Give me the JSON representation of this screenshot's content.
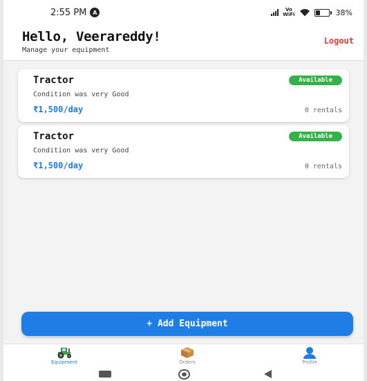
{
  "status_bar": {
    "time": "2:55 PM",
    "network_label_top": "Vo",
    "network_label_bottom": "WiFi",
    "battery": "38%",
    "battery_level": 0.38
  },
  "header": {
    "greeting": "Hello, Veerareddy!",
    "subtitle": "Manage your equipment",
    "logout_label": "Logout"
  },
  "equipment": [
    {
      "name": "Tractor",
      "status": "Available",
      "description": "Condition was very Good",
      "price": "₹1,500/day",
      "rentals": "0 rentals"
    },
    {
      "name": "Tractor",
      "status": "Available",
      "description": "Condition was very Good",
      "price": "₹1,500/day",
      "rentals": "0 rentals"
    }
  ],
  "add_button_label": "+ Add Equipment",
  "bottom_nav": [
    {
      "label": "Equipment",
      "icon": "tractor-icon",
      "active": true
    },
    {
      "label": "Orders",
      "icon": "box-icon",
      "active": false
    },
    {
      "label": "Profile",
      "icon": "person-icon",
      "active": false
    }
  ],
  "colors": {
    "accent": "#1e7de0",
    "badge": "#35b14a",
    "logout": "#e53935"
  }
}
